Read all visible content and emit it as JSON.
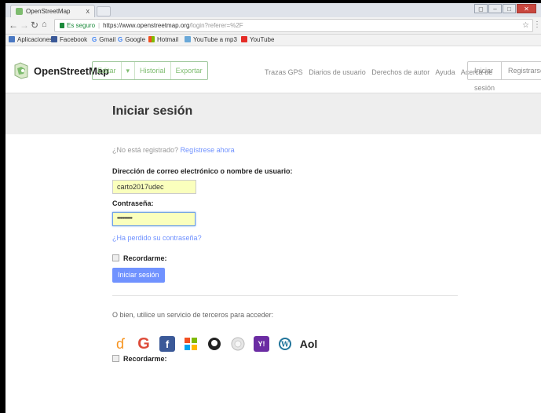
{
  "browser": {
    "tab_title": "OpenStreetMap",
    "tab_close": "x",
    "secure_label": "Es seguro",
    "url_domain": "https://www.openstreetmap.org",
    "url_path": "/login?referer=%2F"
  },
  "bookmarks": {
    "apps": "Aplicaciones",
    "facebook": "Facebook",
    "gmail": "Gmail",
    "google": "Google",
    "hotmail": "Hotmail",
    "youtube_mp3": "YouTube a mp3",
    "youtube": "YouTube"
  },
  "osm": {
    "brand": "OpenStreetMap",
    "edit": "Editar",
    "edit_dropdown": "▾",
    "history": "Historial",
    "export": "Exportar",
    "nav": [
      "Trazas GPS",
      "Diarios de usuario",
      "Derechos de autor",
      "Ayuda",
      "Acerca de"
    ],
    "login": "Iniciar sesión",
    "register": "Registrarse"
  },
  "page": {
    "title": "Iniciar sesión",
    "not_registered": "¿No está registrado?",
    "register_now": "Regístrese ahora",
    "email_label": "Dirección de correo electrónico o nombre de usuario:",
    "email_value": "carto2017udec",
    "password_label": "Contraseña:",
    "password_value": "•••••••••••••",
    "forgot": "¿Ha perdido su contraseña?",
    "remember": "Recordarme:",
    "submit": "Iniciar sesión",
    "third_party": "O bien, utilice un servicio de terceros para acceder:",
    "remember2": "Recordarme:"
  },
  "colors": {
    "osm_green": "#7ebc6f",
    "osm_blue": "#7092ff",
    "autofill": "#faffbd"
  },
  "social_icons": [
    "openid-icon",
    "google-icon",
    "facebook-icon",
    "windows-live-icon",
    "github-icon",
    "wikipedia-icon",
    "yahoo-icon",
    "wordpress-icon",
    "aol-icon"
  ]
}
